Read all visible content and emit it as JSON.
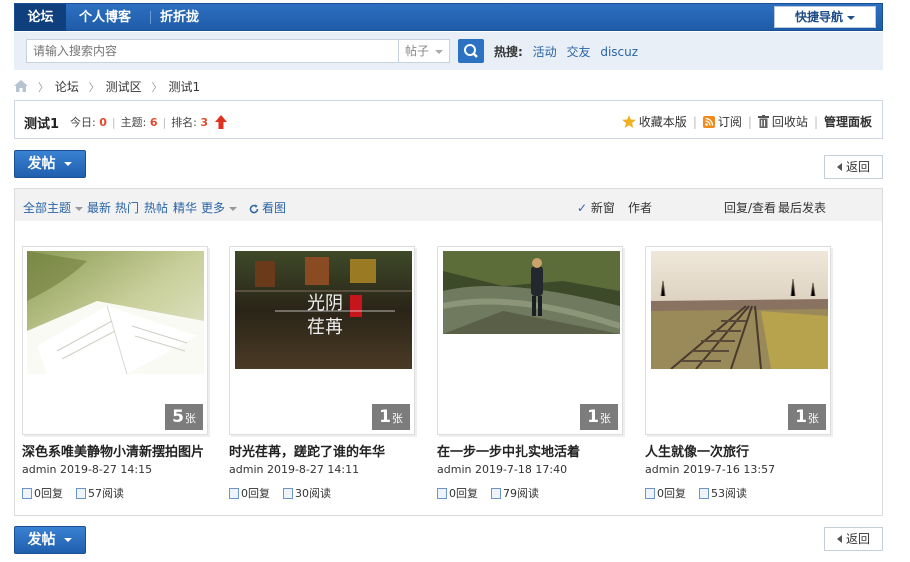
{
  "topnav": {
    "tabs": [
      "论坛",
      "个人博客",
      "折折拢"
    ],
    "quick_nav": "快捷导航"
  },
  "search": {
    "placeholder": "请输入搜索内容",
    "type": "帖子",
    "hot_label": "热搜:",
    "hot_keywords": [
      "活动",
      "交友",
      "discuz"
    ]
  },
  "breadcrumb": [
    "论坛",
    "测试区",
    "测试1"
  ],
  "forum": {
    "name": "测试1",
    "today_label": "今日:",
    "today": "0",
    "topics_label": "主题:",
    "topics": "6",
    "rank_label": "排名:",
    "rank": "3",
    "tools": [
      "收藏本版",
      "订阅",
      "回收站",
      "管理面板"
    ]
  },
  "actions": {
    "post": "发帖",
    "back": "返回"
  },
  "filters": {
    "all": "全部主题",
    "tabs": [
      "最新",
      "热门",
      "热帖",
      "精华",
      "更多"
    ],
    "view": "看图",
    "new_window": "新窗",
    "author": "作者",
    "reply_view": "回复/查看",
    "last_post": "最后发表"
  },
  "cards": [
    {
      "title": "深色系唯美静物小清新摆拍图片",
      "meta": "admin 2019-8-27 14:15",
      "count": "5",
      "unit": "张",
      "replies": "0回复",
      "reads": "57阅读"
    },
    {
      "title": "时光荏苒，蹉跎了谁的年华",
      "meta": "admin 2019-8-27 14:11",
      "count": "1",
      "unit": "张",
      "replies": "0回复",
      "reads": "30阅读"
    },
    {
      "title": "在一步一步中扎实地活着",
      "meta": "admin 2019-7-18 17:40",
      "count": "1",
      "unit": "张",
      "replies": "0回复",
      "reads": "79阅读"
    },
    {
      "title": "人生就像一次旅行",
      "meta": "admin 2019-7-16 13:57",
      "count": "1",
      "unit": "张",
      "replies": "0回复",
      "reads": "53阅读"
    }
  ],
  "image_text": {
    "poster_line1": "光阴",
    "poster_line2": "荏苒"
  }
}
